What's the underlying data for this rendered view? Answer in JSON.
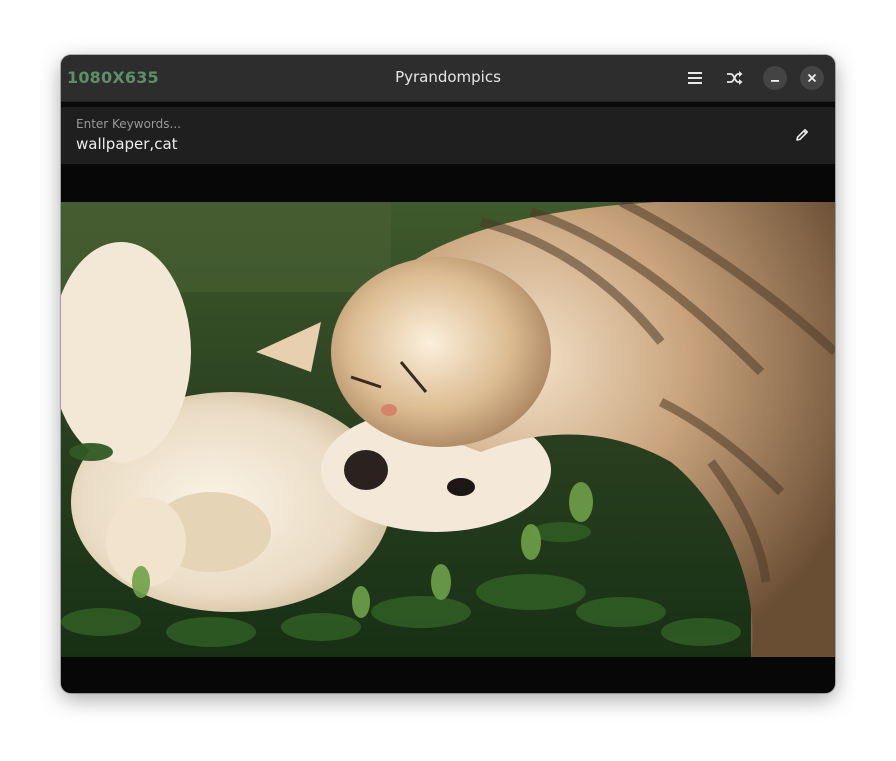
{
  "window": {
    "resolution_label": "1080X635",
    "title": "Pyrandompics",
    "accent_color": "#5f8f67"
  },
  "toolbar": {
    "menu_icon": "hamburger-menu-icon",
    "shuffle_icon": "shuffle-icon",
    "minimize_icon": "minimize-icon",
    "close_icon": "close-icon"
  },
  "search": {
    "placeholder": "Enter Keywords...",
    "value": "wallpaper,cat",
    "edit_icon": "pencil-icon"
  },
  "image": {
    "description_alt": "cat and puppy on grass"
  }
}
